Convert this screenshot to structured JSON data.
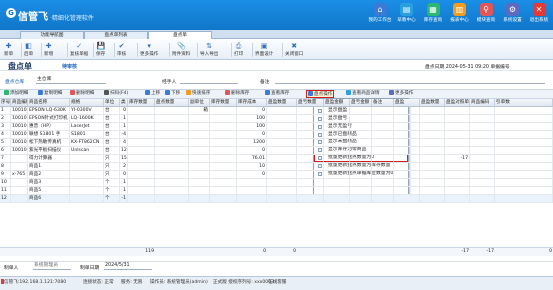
{
  "app": {
    "logo_mark": "G",
    "brand": "信管飞",
    "subtitle": "·精细化管理软件"
  },
  "top_nav": [
    {
      "label": "我的工作台",
      "icon": "home-icon",
      "color": "#3a7bd5"
    },
    {
      "label": "早教中心",
      "icon": "book-icon",
      "color": "#2aa0e0"
    },
    {
      "label": "库存查询",
      "icon": "warehouse-icon",
      "color": "#2bb673"
    },
    {
      "label": "报表中心",
      "icon": "chart-icon",
      "color": "#f29b1d"
    },
    {
      "label": "模块查询",
      "icon": "search-icon",
      "color": "#e15656"
    },
    {
      "label": "系统设置",
      "icon": "gear-icon",
      "color": "#5c6bc0"
    },
    {
      "label": "退出系统",
      "icon": "exit-icon",
      "color": "#e53935"
    }
  ],
  "tabs": [
    "功能导航图",
    "盘点单列表",
    "盘点单"
  ],
  "toolbar": [
    "新单",
    "后单",
    "新增",
    "复核单据",
    "保存",
    "审核",
    "更多操作",
    "附件资料",
    "导入导出",
    "打印",
    "界面设计",
    "关闭窗口"
  ],
  "form": {
    "title": "盘点单",
    "doc_type": "待审核",
    "date_label": "盘点日期 2024-05-31 09:20 单据编号",
    "warehouse_label": "盘点仓库",
    "warehouse_value": "主仓库",
    "handler_label": "经手人",
    "note_label": "备注"
  },
  "grid_toolbar": [
    "添加明细",
    "复制明细",
    "删除明细",
    "扫码(F4)",
    "上移",
    "下移",
    "快速排序",
    "删除库存",
    "查看库存",
    "盘点操作",
    "查看商品详情",
    "更多操作"
  ],
  "columns": [
    "序号",
    "商品编码",
    "商品名称",
    "规格",
    "单位",
    "类",
    "库存数量",
    "盘点数量",
    "副单位",
    "库存数量",
    "库存成本",
    "盘盈数量",
    "盘亏数量",
    "盘盈金额",
    "盘亏金额",
    "备注",
    "盘盈",
    "盘盈数量",
    "盘盈对照单",
    "商品编码",
    "引单数"
  ],
  "rows": [
    [
      "1",
      "100101001",
      "EPSON LQ-630K",
      "YI-0300V",
      "台",
      "0",
      "",
      "",
      "箱",
      "",
      "0",
      "",
      "",
      "",
      "",
      "",
      "",
      "",
      "",
      "",
      ""
    ],
    [
      "2",
      "100101002",
      "EPSON针式打印机",
      "LQ-1600K",
      "台",
      "1",
      "",
      "",
      "",
      "",
      "100",
      "",
      "",
      "",
      "",
      "",
      "",
      "",
      "",
      "",
      ""
    ],
    [
      "3",
      "100101003",
      "惠普（HP）",
      "LaserJet",
      "台",
      "1",
      "",
      "",
      "",
      "",
      "100",
      "",
      "",
      "",
      "",
      "",
      "",
      "",
      "",
      "",
      ""
    ],
    [
      "4",
      "100101004",
      "联想 S1801 手",
      "S1801",
      "台",
      "-4",
      "",
      "",
      "",
      "",
      "0",
      "",
      "",
      "",
      "",
      "",
      "",
      "",
      "",
      "",
      ""
    ],
    [
      "5",
      "100102001",
      "松下热敏传真机",
      "KX-FT862CN",
      "台",
      "4",
      "",
      "",
      "",
      "",
      "1200",
      "",
      "",
      "",
      "",
      "",
      "",
      "",
      "",
      "",
      ""
    ],
    [
      "6",
      "100101005",
      "紫光平板扫描仪",
      "Unlscan",
      "台",
      "12",
      "",
      "",
      "",
      "",
      "0",
      "",
      "",
      "",
      "",
      "",
      "",
      "",
      "",
      "",
      ""
    ],
    [
      "7",
      "",
      "得力计算器",
      "",
      "只",
      "15",
      "",
      "",
      "",
      "",
      "76.01",
      "",
      "",
      "",
      "",
      "",
      "",
      "",
      "-17",
      "",
      ""
    ],
    [
      "8",
      "",
      "商品1",
      "",
      "只",
      "2",
      "",
      "",
      "",
      "",
      "10",
      "",
      "",
      "",
      "",
      "",
      "",
      "",
      "",
      "",
      ""
    ],
    [
      "9",
      "x-765",
      "商品2",
      "",
      "只",
      "0",
      "",
      "",
      "",
      "",
      "0",
      "",
      "",
      "",
      "",
      "",
      "",
      "",
      "",
      "",
      ""
    ],
    [
      "10",
      "",
      "商品3",
      "",
      "个",
      "1",
      "",
      "",
      "",
      "",
      "",
      "",
      "",
      "",
      "",
      "",
      "",
      "",
      "",
      "",
      ""
    ],
    [
      "11",
      "",
      "商品5",
      "",
      "个",
      "1",
      "",
      "",
      "",
      "",
      "",
      "",
      "",
      "",
      "",
      "",
      "",
      "",
      "",
      "",
      ""
    ],
    [
      "12",
      "",
      "商品6",
      "",
      "个",
      "-1",
      "",
      "",
      "",
      "",
      "",
      "",
      "",
      "",
      "",
      "",
      "",
      "",
      "",
      "",
      ""
    ]
  ],
  "totals": {
    "qty": "119",
    "cost": "0",
    "profit": "0",
    "v1": "-17",
    "v2": "-17",
    "v3": "0"
  },
  "context_menu": [
    {
      "label": "显示全部",
      "hl": true
    },
    {
      "label": "显示盘盈"
    },
    {
      "label": "显示盘亏"
    },
    {
      "label": "显示无盈亏"
    },
    {
      "label": "显示已盘商品"
    },
    {
      "label": "显示未盘商品"
    },
    {
      "label": "显示库存为零商品"
    },
    {
      "label": "批量更新盘点数量为0",
      "boxed": true
    },
    {
      "label": "批量更新盘点数量为库存数量"
    },
    {
      "label": "批量更新盘点单据库位数量为0"
    }
  ],
  "bottom_form": {
    "handler_label": "制单人",
    "handler_value": "系统管理员",
    "date_label": "制单日期",
    "date_value": "2024/5/31"
  },
  "status_bar": [
    "信管飞:192.168.1.121:7080",
    "连接状态: 正常",
    "服务: 无限",
    "操作员: 系统管理员(admin)",
    "正式版 授权序列号: xxx0003",
    "在线客服"
  ]
}
